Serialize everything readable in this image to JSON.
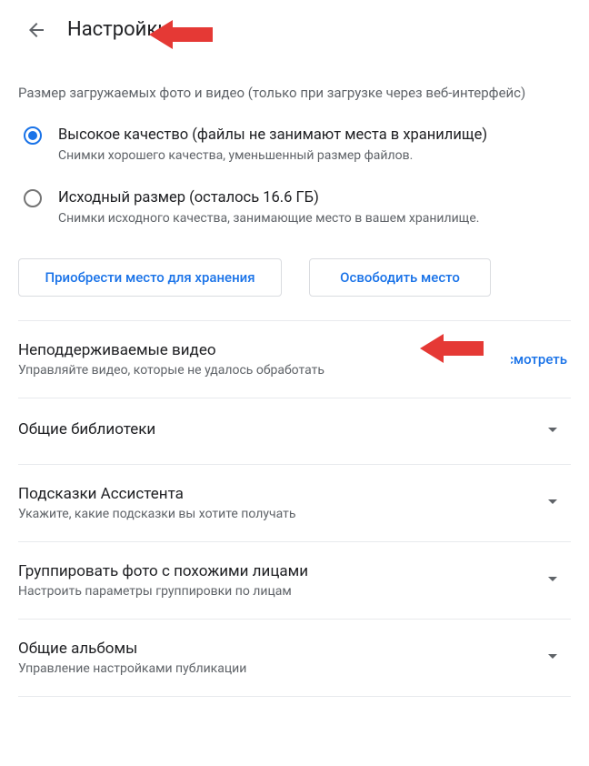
{
  "header": {
    "title": "Настройки"
  },
  "upload": {
    "heading": "Размер загружаемых фото и видео (только при загрузке через веб-интерфейс)",
    "options": [
      {
        "label": "Высокое качество (файлы не занимают места в хранилище)",
        "sub": "Снимки хорошего качества, уменьшенный размер файлов.",
        "selected": true
      },
      {
        "label": "Исходный размер (осталось 16.6 ГБ)",
        "sub": "Снимки исходного качества, занимающие место в вашем хранилище.",
        "selected": false
      }
    ],
    "buttons": {
      "buy": "Приобрести место для хранения",
      "free": "Освободить место"
    }
  },
  "rows": {
    "unsupported": {
      "title": "Неподдерживаемые видео",
      "sub": "Управляйте видео, которые не удалось обработать",
      "link": "Просмотреть"
    },
    "shared_libs": {
      "title": "Общие библиотеки"
    },
    "assistant": {
      "title": "Подсказки Ассистента",
      "sub": "Укажите, какие подсказки вы хотите получать"
    },
    "faces": {
      "title": "Группировать фото с похожими лицами",
      "sub": "Настроить параметры группировки по лицам"
    },
    "shared_albums": {
      "title": "Общие альбомы",
      "sub": "Управление настройками публикации"
    }
  }
}
